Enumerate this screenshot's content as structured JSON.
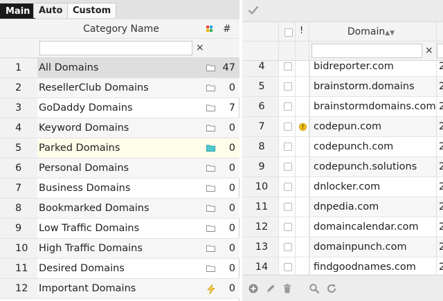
{
  "tabs": [
    {
      "label": "Main",
      "active": true
    },
    {
      "label": "Auto",
      "active": false
    },
    {
      "label": "Custom",
      "active": false
    }
  ],
  "categories": {
    "header": {
      "name": "Category Name",
      "count": "#"
    },
    "filter_clear": "×",
    "rows": [
      {
        "num": "1",
        "name": "All Domains",
        "count": "47",
        "icon": "folder-icon"
      },
      {
        "num": "2",
        "name": "ResellerClub Domains",
        "count": "0",
        "icon": "folder-icon"
      },
      {
        "num": "3",
        "name": "GoDaddy Domains",
        "count": "7",
        "icon": "folder-icon"
      },
      {
        "num": "4",
        "name": "Keyword Domains",
        "count": "0",
        "icon": "folder-icon"
      },
      {
        "num": "5",
        "name": "Parked Domains",
        "count": "0",
        "icon": "folder-icon"
      },
      {
        "num": "6",
        "name": "Personal Domains",
        "count": "0",
        "icon": "folder-icon"
      },
      {
        "num": "7",
        "name": "Business Domains",
        "count": "0",
        "icon": "folder-icon"
      },
      {
        "num": "8",
        "name": "Bookmarked Domains",
        "count": "0",
        "icon": "folder-icon"
      },
      {
        "num": "9",
        "name": "Low Traffic Domains",
        "count": "0",
        "icon": "folder-icon"
      },
      {
        "num": "10",
        "name": "High Traffic Domains",
        "count": "0",
        "icon": "folder-icon"
      },
      {
        "num": "11",
        "name": "Desired Domains",
        "count": "0",
        "icon": "folder-icon"
      },
      {
        "num": "12",
        "name": "Important Domains",
        "count": "0",
        "icon": "lightning-icon"
      }
    ]
  },
  "domains": {
    "header": {
      "flag": "!",
      "domain": "Domain",
      "sort": "▲▼"
    },
    "filter_clear": "×",
    "rows": [
      {
        "num": "4",
        "name": "bidreporter.com",
        "extra": "2",
        "warn": false
      },
      {
        "num": "5",
        "name": "brainstorm.domains",
        "extra": "2",
        "warn": false
      },
      {
        "num": "6",
        "name": "brainstormdomains.com",
        "extra": "2",
        "warn": false
      },
      {
        "num": "7",
        "name": "codepun.com",
        "extra": "2",
        "warn": true
      },
      {
        "num": "8",
        "name": "codepunch.com",
        "extra": "2",
        "warn": false
      },
      {
        "num": "9",
        "name": "codepunch.solutions",
        "extra": "2",
        "warn": false
      },
      {
        "num": "10",
        "name": "dnlocker.com",
        "extra": "2",
        "warn": false
      },
      {
        "num": "11",
        "name": "dnpedia.com",
        "extra": "2",
        "warn": false
      },
      {
        "num": "12",
        "name": "domaincalendar.com",
        "extra": "2",
        "warn": false
      },
      {
        "num": "13",
        "name": "domainpunch.com",
        "extra": "2",
        "warn": false
      },
      {
        "num": "14",
        "name": "findgoodnames.com",
        "extra": "2",
        "warn": false
      }
    ],
    "warn_glyph": "!"
  },
  "colors": {
    "accent": "#2ab3c0",
    "warn": "#f1c21b",
    "lightning": "#e0a400"
  }
}
